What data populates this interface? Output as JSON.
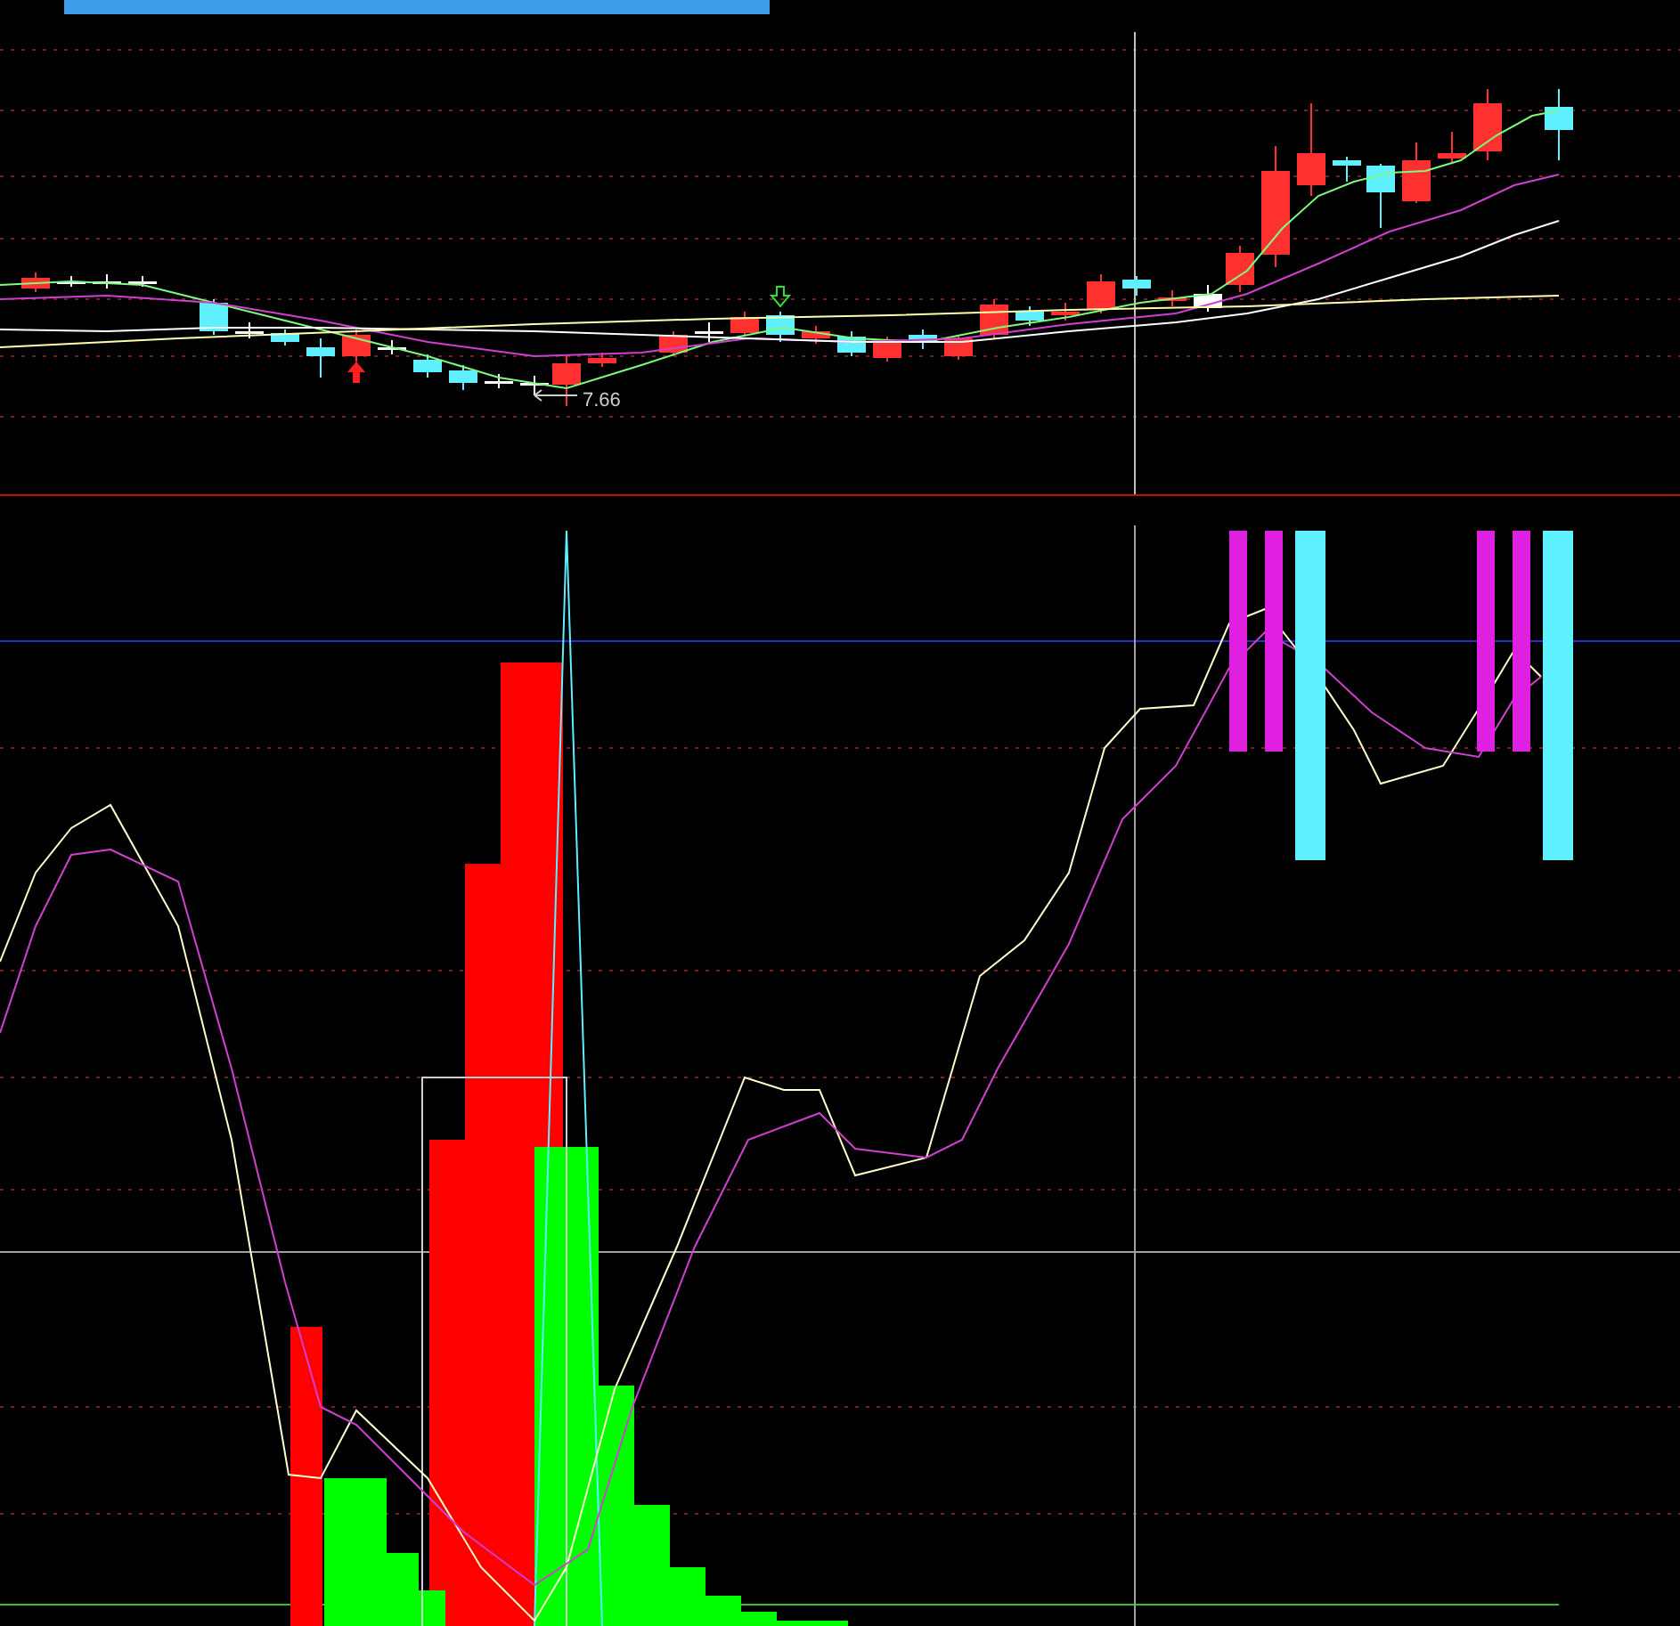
{
  "price_chart": {
    "low_price_label": "7.66"
  }
}
